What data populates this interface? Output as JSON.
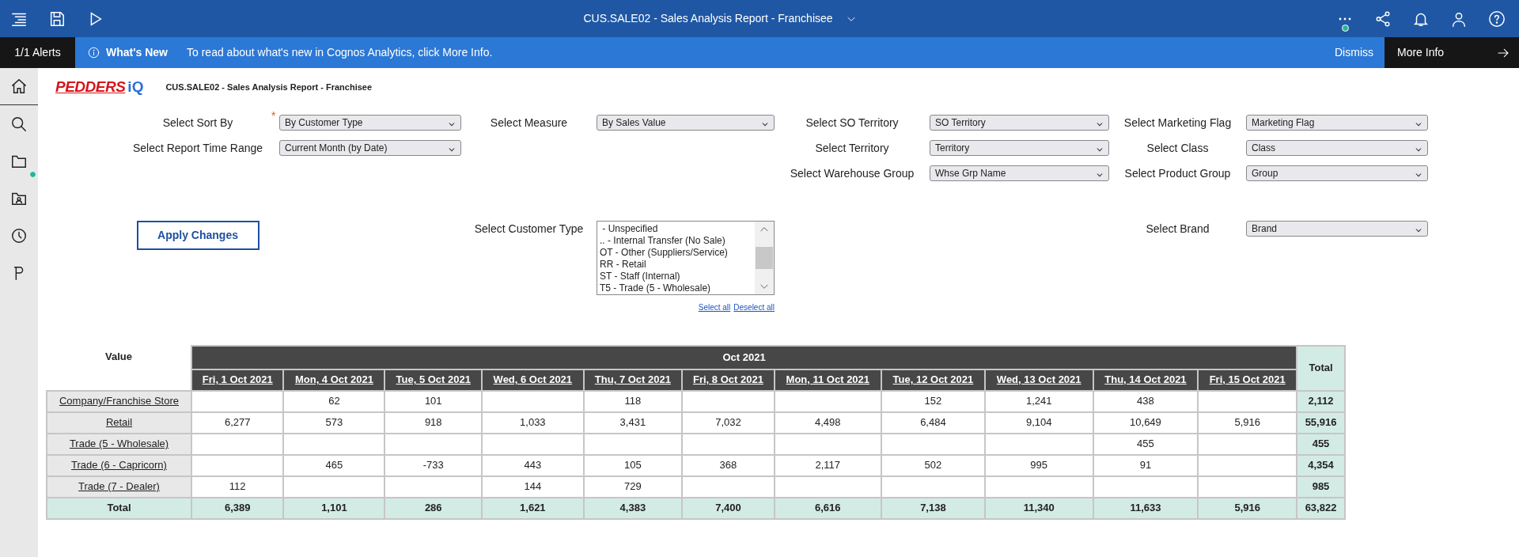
{
  "topbar": {
    "title": "CUS.SALE02 - Sales Analysis Report - Franchisee",
    "more_notification": true
  },
  "alerts": {
    "count": "1/1 Alerts",
    "heading": "What's New",
    "message": "To read about what's new in Cognos Analytics, click More Info.",
    "dismiss": "Dismiss",
    "more": "More Info"
  },
  "sidebar": {
    "items": [
      {
        "kind": "home",
        "selected": true,
        "notification": false
      },
      {
        "kind": "search",
        "selected": false,
        "notification": false
      },
      {
        "kind": "folder",
        "selected": false,
        "notification": true
      },
      {
        "kind": "team-folder",
        "selected": false,
        "notification": false
      },
      {
        "kind": "recent",
        "selected": false,
        "notification": false
      },
      {
        "kind": "brand",
        "selected": false,
        "notification": false
      }
    ]
  },
  "report": {
    "logo": {
      "text": "PEDDERS",
      "suffix": "iQ"
    },
    "title": "CUS.SALE02 - Sales Analysis Report - Franchisee"
  },
  "filters": [
    {
      "kind": "select",
      "label": "Select Sort By",
      "required_mark": "*",
      "value": "By Customer Type"
    },
    {
      "kind": "select",
      "label": "Select Measure",
      "value": "By Sales Value"
    },
    {
      "kind": "select",
      "label": "Select SO Territory",
      "value": "SO Territory"
    },
    {
      "kind": "select",
      "label": "Select Marketing Flag",
      "value": "Marketing Flag"
    },
    {
      "kind": "select",
      "label": "Select Report Time Range",
      "value": "Current Month (by Date)"
    },
    {
      "kind": "select",
      "label": "Select Territory",
      "value": "Territory"
    },
    {
      "kind": "select",
      "label": "Select Class",
      "value": "Class"
    },
    {
      "kind": "select",
      "label": "Select Warehouse Group",
      "value": "Whse Grp Name"
    },
    {
      "kind": "select",
      "label": "Select Product Group",
      "value": "Group"
    },
    {
      "kind": "listbox",
      "label": "Select Customer Type",
      "options": [
        " - Unspecified",
        ".. - Internal Transfer (No Sale)",
        "OT - Other (Suppliers/Service)",
        "RR - Retail",
        "ST - Staff (Internal)",
        "T5 - Trade (5 - Wholesale)"
      ],
      "select_all": "Select all",
      "deselect_all": "Deselect all"
    },
    {
      "kind": "select",
      "label": "Select Brand",
      "value": "Brand"
    }
  ],
  "apply_button": "Apply Changes",
  "table": {
    "corner": "Value",
    "group": "Oct 2021",
    "total_header": "Total",
    "columns": [
      "Fri, 1 Oct 2021",
      "Mon, 4 Oct 2021",
      "Tue, 5 Oct 2021",
      "Wed, 6 Oct 2021",
      "Thu, 7 Oct 2021",
      "Fri, 8 Oct 2021",
      "Mon, 11 Oct 2021",
      "Tue, 12 Oct 2021",
      "Wed, 13 Oct 2021",
      "Thu, 14 Oct 2021",
      "Fri, 15 Oct 2021"
    ],
    "rows": [
      {
        "label": "Company/Franchise Store",
        "cells": [
          "",
          "62",
          "101",
          "",
          "118",
          "",
          "",
          "152",
          "1,241",
          "438",
          ""
        ],
        "total": "2,112"
      },
      {
        "label": "Retail",
        "cells": [
          "6,277",
          "573",
          "918",
          "1,033",
          "3,431",
          "7,032",
          "4,498",
          "6,484",
          "9,104",
          "10,649",
          "5,916"
        ],
        "total": "55,916"
      },
      {
        "label": "Trade (5 - Wholesale)",
        "cells": [
          "",
          "",
          "",
          "",
          "",
          "",
          "",
          "",
          "",
          "455",
          ""
        ],
        "total": "455"
      },
      {
        "label": "Trade (6 - Capricorn)",
        "cells": [
          "",
          "465",
          "-733",
          "443",
          "105",
          "368",
          "2,117",
          "502",
          "995",
          "91",
          ""
        ],
        "total": "4,354"
      },
      {
        "label": "Trade (7 - Dealer)",
        "cells": [
          "112",
          "",
          "",
          "144",
          "729",
          "",
          "",
          "",
          "",
          "",
          ""
        ],
        "total": "985"
      }
    ],
    "total_row": {
      "label": "Total",
      "cells": [
        "6,389",
        "1,101",
        "286",
        "1,621",
        "4,383",
        "7,400",
        "6,616",
        "7,138",
        "11,340",
        "11,633",
        "5,916"
      ],
      "total": "63,822"
    }
  }
}
